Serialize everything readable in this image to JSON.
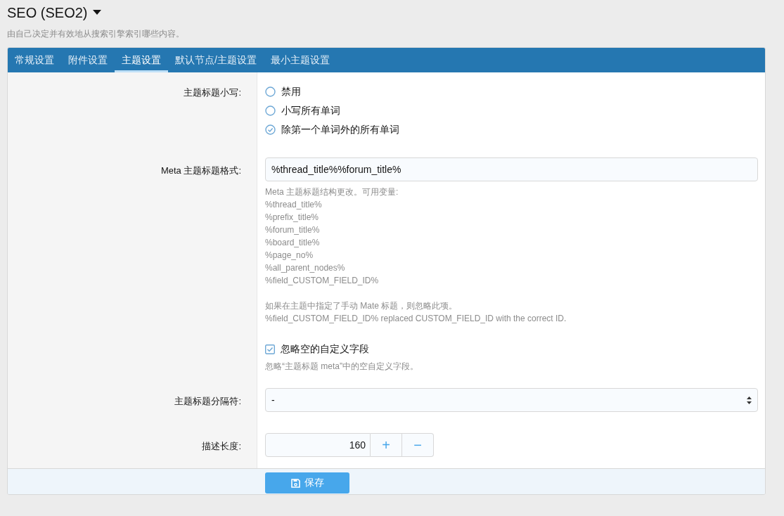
{
  "page": {
    "title": "SEO (SEO2)",
    "description": "由自己决定并有效地从搜索引擎索引哪些内容。"
  },
  "tabs": [
    {
      "label": "常规设置",
      "selected": false
    },
    {
      "label": "附件设置",
      "selected": false
    },
    {
      "label": "主题设置",
      "selected": true
    },
    {
      "label": "默认节点/主题设置",
      "selected": false
    },
    {
      "label": "最小主题设置",
      "selected": false
    }
  ],
  "fields": [
    {
      "kind": "radio",
      "label": "主题标题小写:",
      "options": [
        {
          "label": "禁用",
          "selected": false
        },
        {
          "label": "小写所有单词",
          "selected": false
        },
        {
          "label": "除第一个单词外的所有单词",
          "selected": true
        }
      ]
    },
    {
      "kind": "text",
      "label": "Meta 主题标题格式:",
      "value": "%thread_title%%forum_title%",
      "help": [
        "Meta 主题标题结构更改。可用变量:",
        "%thread_title%",
        "%prefix_title%",
        "%forum_title%",
        "%board_title%",
        "%page_no%",
        "%all_parent_nodes%",
        "%field_CUSTOM_FIELD_ID%"
      ],
      "notes": [
        "如果在主题中指定了手动 Mate 标题，则忽略此项。",
        "%field_CUSTOM_FIELD_ID% replaced CUSTOM_FIELD_ID with the correct ID."
      ]
    },
    {
      "kind": "checkbox",
      "label": "忽略空的自定义字段",
      "checked": true,
      "hint": "忽略“主题标题 meta”中的空自定义字段。"
    },
    {
      "kind": "select",
      "label": "主题标题分隔符:",
      "value": "-"
    },
    {
      "kind": "number",
      "label": "描述长度:",
      "value": "160",
      "plus": "+",
      "minus": "−"
    }
  ],
  "save_button": {
    "label": "保存"
  }
}
